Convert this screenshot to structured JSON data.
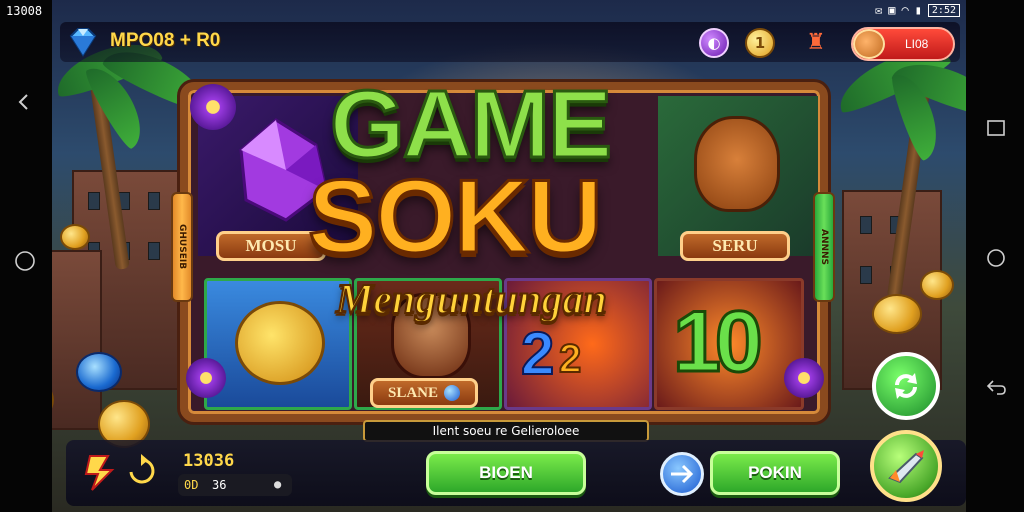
{
  "status_bar": {
    "time": "13008",
    "icons": [
      "notification-icon",
      "sim-icon",
      "wifi-icon",
      "signal-icon",
      "battery-icon"
    ],
    "extra": "2:52"
  },
  "top_hud": {
    "player_name": "MPO08 + R0",
    "profile_text": "LI08",
    "icons": [
      "gem-icon",
      "purple-token-icon",
      "gold-coin-icon",
      "trophy-icon"
    ]
  },
  "title": {
    "line1": "GAME",
    "line2": "SOKU",
    "subtitle": "Menguntungan"
  },
  "plaques": {
    "left": "MOSU",
    "right": "SERU",
    "reel": "SLANE"
  },
  "side_tabs": {
    "left": "GHUSEIB",
    "right": "ANNNS"
  },
  "reel_symbols": {
    "number_a": "2",
    "number_b": "2",
    "number_c": "10"
  },
  "info_text": "Ilent soeu re Gelieroloee",
  "bottom_hud": {
    "balance": "13036",
    "sub_balance_a": "0D",
    "sub_balance_b": "36",
    "left_button_label": "BIOEN",
    "right_button_label": "POKIN"
  },
  "colors": {
    "accent_green": "#2ea82a",
    "accent_gold": "#ffd84a",
    "frame_brown": "#8a4a1e",
    "profile_red": "#c01a1a"
  }
}
